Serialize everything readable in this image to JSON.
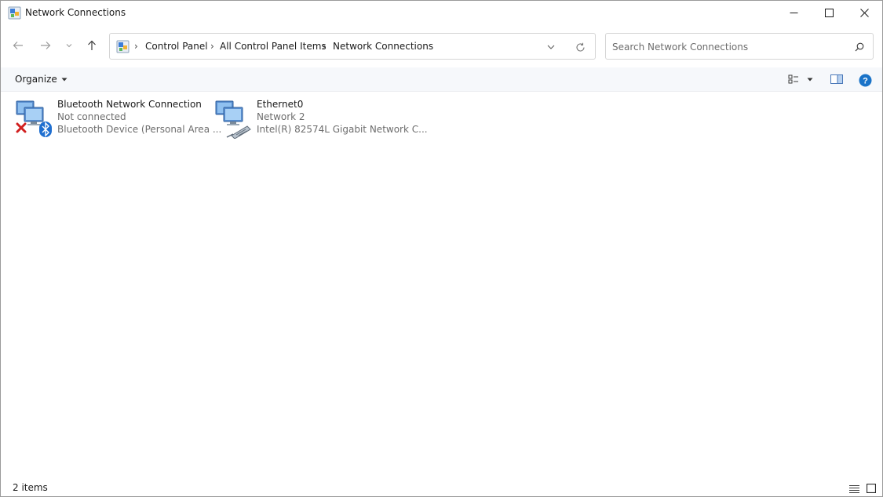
{
  "window": {
    "title": "Network Connections",
    "app_icon": "network-connections-icon",
    "caption_icons": [
      "minimize-icon",
      "maximize-icon",
      "close-icon"
    ]
  },
  "nav": {
    "back_icon": "arrow-left-icon",
    "forward_icon": "arrow-right-icon",
    "recent_icon": "chevron-down-icon",
    "up_icon": "arrow-up-icon"
  },
  "address": {
    "icon": "control-panel-icon",
    "breadcrumbs": [
      "Control Panel",
      "All Control Panel Items",
      "Network Connections"
    ],
    "separator": "›",
    "dropdown_icon": "chevron-down-icon",
    "refresh_icon": "refresh-icon"
  },
  "search": {
    "placeholder": "Search Network Connections",
    "value": "",
    "icon": "search-icon"
  },
  "commandbar": {
    "organize_label": "Organize",
    "view_icon": "change-view-icon",
    "preview_icon": "preview-pane-icon",
    "help_icon": "help-icon",
    "accent_color": "#1a73c8"
  },
  "connections": [
    {
      "name": "Bluetooth Network Connection",
      "status": "Not connected",
      "device": "Bluetooth Device (Personal Area ...",
      "icon": "bluetooth-network-icon",
      "overlay_icons": [
        "disconnected-x-icon",
        "bluetooth-icon"
      ]
    },
    {
      "name": "Ethernet0",
      "status": "Network 2",
      "device": "Intel(R) 82574L Gigabit Network C...",
      "icon": "ethernet-network-icon",
      "overlay_icons": [
        "network-cable-icon"
      ]
    }
  ],
  "statusbar": {
    "item_count": "2 items",
    "details_view_icon": "details-view-icon",
    "tiles_view_icon": "large-icons-view-icon"
  }
}
